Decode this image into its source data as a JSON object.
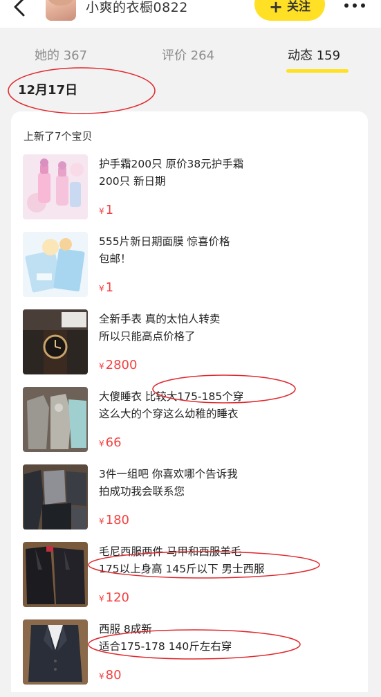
{
  "header": {
    "back_icon": "chevron-left-icon",
    "shop_name": "小爽的衣橱0822",
    "follow_label": "关注",
    "more_icon": "more-dots-icon"
  },
  "tabs": [
    {
      "label": "她的 367",
      "active": false
    },
    {
      "label": "评价 264",
      "active": false
    },
    {
      "label": "动态 159",
      "active": true
    }
  ],
  "feed": {
    "date": "12月17日",
    "card_title": "上新了7个宝贝",
    "currency": "¥",
    "items": [
      {
        "line1": "护手霜200只 原价38元护手霜",
        "line2": "200只 新日期",
        "price": "1"
      },
      {
        "line1": "555片新日期面膜 惊喜价格",
        "line2": "包邮！",
        "price": "1"
      },
      {
        "line1": "全新手表 真的太怕人转卖",
        "line2": "所以只能高点价格了",
        "price": "2800"
      },
      {
        "line1": "大傻睡衣 比较大175-185个穿",
        "line2": "这么大的个穿这么幼稚的睡衣",
        "price": "66"
      },
      {
        "line1": "3件一组吧 你喜欢哪个告诉我",
        "line2": "拍成功我会联系您",
        "price": "180"
      },
      {
        "line1": "毛尼西服两件 马甲和西服羊毛",
        "line2": "175以上身高 145斤以下 男士西服",
        "price": "120"
      },
      {
        "line1": "西服 8成新",
        "line2": "适合175-178 140斤左右穿",
        "price": "80"
      }
    ]
  },
  "colors": {
    "accent_yellow": "#ffe024",
    "price_red": "#f24141",
    "annotation_red": "#e0282d"
  }
}
